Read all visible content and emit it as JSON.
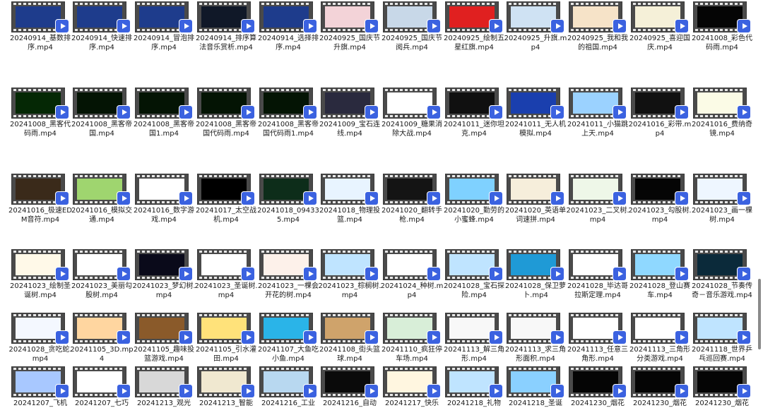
{
  "files": [
    {
      "label": "20240914_基数排序.mp4",
      "thumb": "#1e3c8c"
    },
    {
      "label": "20240914_快速排序.mp4",
      "thumb": "#1e3c8c"
    },
    {
      "label": "20240914_冒泡排序.mp4",
      "thumb": "#1e3c8c"
    },
    {
      "label": "20240914_排序算法音乐赏析.mp4",
      "thumb": "#101828"
    },
    {
      "label": "20240914_选择排序.mp4",
      "thumb": "#1e3c8c"
    },
    {
      "label": "20240925_国庆节升旗.mp4",
      "thumb": "#f3d3d8"
    },
    {
      "label": "20240925_国庆节阅兵.mp4",
      "thumb": "#c8d8e8"
    },
    {
      "label": "20240925_绘制五星红旗.mp4",
      "thumb": "#e02020"
    },
    {
      "label": "20240925_升旗.mp4",
      "thumb": "#cfe2f3"
    },
    {
      "label": "20240925_我和我的祖国.mp4",
      "thumb": "#f6e3c8"
    },
    {
      "label": "20240925_喜迎国庆.mp4",
      "thumb": "#f5f0d8"
    },
    {
      "label": "20241008_彩色代码雨.mp4",
      "thumb": "#050505"
    },
    {
      "label": "20241008_黑客代码雨.mp4",
      "thumb": "#052805"
    },
    {
      "label": "20241008_黑客帝国.mp4",
      "thumb": "#041404"
    },
    {
      "label": "20241008_黑客帝国1.mp4",
      "thumb": "#041404"
    },
    {
      "label": "20241008_黑客帝国代码雨.mp4",
      "thumb": "#041404"
    },
    {
      "label": "20241008_黑客帝国代码雨1.mp4",
      "thumb": "#041404"
    },
    {
      "label": "20241009_宝石连线.mp4",
      "thumb": "#2a2a3e"
    },
    {
      "label": "20241009_糖果消除大战.mp4",
      "thumb": "#ffffff"
    },
    {
      "label": "20241011_迷你坦克.mp4",
      "thumb": "#101010"
    },
    {
      "label": "20241011_无人机模拟.mp4",
      "thumb": "#1a3fae"
    },
    {
      "label": "20241011_小猫跳上天.mp4",
      "thumb": "#9bd2ff"
    },
    {
      "label": "20241016_彩带.mp4",
      "thumb": "#111111"
    },
    {
      "label": "20241016_费纳奇镜.mp4",
      "thumb": "#fbfbe6"
    },
    {
      "label": "20241016_极速EDM音符.mp4",
      "thumb": "#3a2a1a"
    },
    {
      "label": "20241016_模拟交通.mp4",
      "thumb": "#9fd56f"
    },
    {
      "label": "20241016_数字游戏.mp4",
      "thumb": "#ffffff"
    },
    {
      "label": "20241017_太空战机.mp4",
      "thumb": "#000000"
    },
    {
      "label": "20241018_094335.mp4",
      "thumb": "#0d2d1a"
    },
    {
      "label": "20241018_物理投篮.mp4",
      "thumb": "#e8f4ff"
    },
    {
      "label": "20241020_翻转手枪.mp4",
      "thumb": "#141414"
    },
    {
      "label": "20241020_勤劳的小蜜蜂.mp4",
      "thumb": "#7fd1ff"
    },
    {
      "label": "20241020_英语单词速拼.mp4",
      "thumb": "#f6eedb"
    },
    {
      "label": "20241023_二叉树.mp4",
      "thumb": "#eef7e8"
    },
    {
      "label": "20241023_勾股树.mp4",
      "thumb": "#050505"
    },
    {
      "label": "20241023_画一棵树.mp4",
      "thumb": "#eef6ff"
    },
    {
      "label": "20241023_绘制圣诞树.mp4",
      "thumb": "#fff9e8"
    },
    {
      "label": "20241023_美丽勾股树.mp4",
      "thumb": "#ffffff"
    },
    {
      "label": "20241023_梦幻树.mp4",
      "thumb": "#0a0a1a"
    },
    {
      "label": "20241023_圣诞树.mp4",
      "thumb": "#ffffff"
    },
    {
      "label": "20241023_一棵会开花的树.mp4",
      "thumb": "#fdf1ea"
    },
    {
      "label": "20241023_棕榈树.mp4",
      "thumb": "#bfe4ff"
    },
    {
      "label": "20241024_种树.mp4",
      "thumb": "#ffffff"
    },
    {
      "label": "20241028_宝石探险.mp4",
      "thumb": "#bfe4ff"
    },
    {
      "label": "20241028_保卫萝卜.mp4",
      "thumb": "#1f9ad6"
    },
    {
      "label": "20241028_毕达哥拉斯定理.mp4",
      "thumb": "#ffffff"
    },
    {
      "label": "20241028_登山赛车.mp4",
      "thumb": "#8fd8ff"
    },
    {
      "label": "20241028_节奏传奇－音乐游戏.mp4",
      "thumb": "#0b2a3a"
    },
    {
      "label": "20241028_贪吃蛇.mp4",
      "thumb": "#f4f8ff"
    },
    {
      "label": "20241105_3D.mp4",
      "thumb": "#ffd6a0"
    },
    {
      "label": "20241105_趣味投篮游戏.mp4",
      "thumb": "#8a5a2a"
    },
    {
      "label": "20241105_引水灌田.mp4",
      "thumb": "#ffe27a"
    },
    {
      "label": "20241107_大鱼吃小鱼.mp4",
      "thumb": "#2ab4e8"
    },
    {
      "label": "20241108_街头篮球.mp4",
      "thumb": "#cfa36b"
    },
    {
      "label": "20241110_疯狂停车场.mp4",
      "thumb": "#d8eed8"
    },
    {
      "label": "20241113_解三角形.mp4",
      "thumb": "#f8f8f8"
    },
    {
      "label": "20241113_求三角形面积.mp4",
      "thumb": "#f8f8f8"
    },
    {
      "label": "20241113_任意三角形.mp4",
      "thumb": "#ffffff"
    },
    {
      "label": "20241113_三角形分类游戏.mp4",
      "thumb": "#ffffff"
    },
    {
      "label": "20241118_世界乒乓巡回赛.mp4",
      "thumb": "#bfe4ff"
    },
    {
      "label": "20241207_飞机",
      "thumb": "#a8c8ff"
    },
    {
      "label": "20241207_七巧",
      "thumb": "#ffffff"
    },
    {
      "label": "20241213_观光",
      "thumb": "#d8d8d8"
    },
    {
      "label": "20241213_智能",
      "thumb": "#f0e8d0"
    },
    {
      "label": "20241216_工业",
      "thumb": "#b8d8f0"
    },
    {
      "label": "20241216_自动",
      "thumb": "#0a0a0a"
    },
    {
      "label": "20241217_快乐",
      "thumb": "#fff6e0"
    },
    {
      "label": "20241218_礼物",
      "thumb": "#bfe4ff"
    },
    {
      "label": "20241218_圣诞",
      "thumb": "#8ad0ff"
    },
    {
      "label": "20241230_烟花",
      "thumb": "#050505"
    },
    {
      "label": "20241230_烟花",
      "thumb": "#050505"
    },
    {
      "label": "20241230_烟花",
      "thumb": "#050505"
    }
  ]
}
